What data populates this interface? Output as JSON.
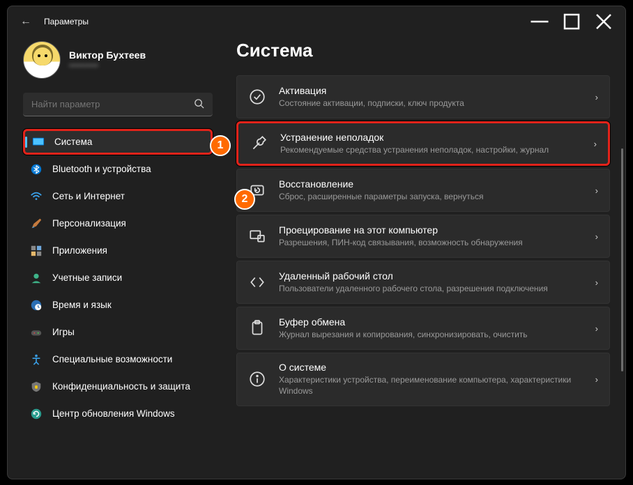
{
  "window": {
    "title": "Параметры"
  },
  "user": {
    "name": "Виктор Бухтеев",
    "subtitle": "••••••••••"
  },
  "search": {
    "placeholder": "Найти параметр"
  },
  "sidebar": {
    "items": [
      {
        "label": "Система"
      },
      {
        "label": "Bluetooth и устройства"
      },
      {
        "label": "Сеть и Интернет"
      },
      {
        "label": "Персонализация"
      },
      {
        "label": "Приложения"
      },
      {
        "label": "Учетные записи"
      },
      {
        "label": "Время и язык"
      },
      {
        "label": "Игры"
      },
      {
        "label": "Специальные возможности"
      },
      {
        "label": "Конфиденциальность и защита"
      },
      {
        "label": "Центр обновления Windows"
      }
    ]
  },
  "page": {
    "title": "Система"
  },
  "cards": [
    {
      "title": "Активация",
      "subtitle": "Состояние активации, подписки, ключ продукта"
    },
    {
      "title": "Устранение неполадок",
      "subtitle": "Рекомендуемые средства устранения неполадок, настройки, журнал"
    },
    {
      "title": "Восстановление",
      "subtitle": "Сброс, расширенные параметры запуска, вернуться"
    },
    {
      "title": "Проецирование на этот компьютер",
      "subtitle": "Разрешения, ПИН-код связывания, возможность обнаружения"
    },
    {
      "title": "Удаленный рабочий стол",
      "subtitle": "Пользователи удаленного рабочего стола, разрешения подключения"
    },
    {
      "title": "Буфер обмена",
      "subtitle": "Журнал вырезания и копирования, синхронизировать, очистить"
    },
    {
      "title": "О системе",
      "subtitle": "Характеристики устройства, переименование компьютера, характеристики Windows"
    }
  ],
  "badges": {
    "one": "1",
    "two": "2"
  }
}
